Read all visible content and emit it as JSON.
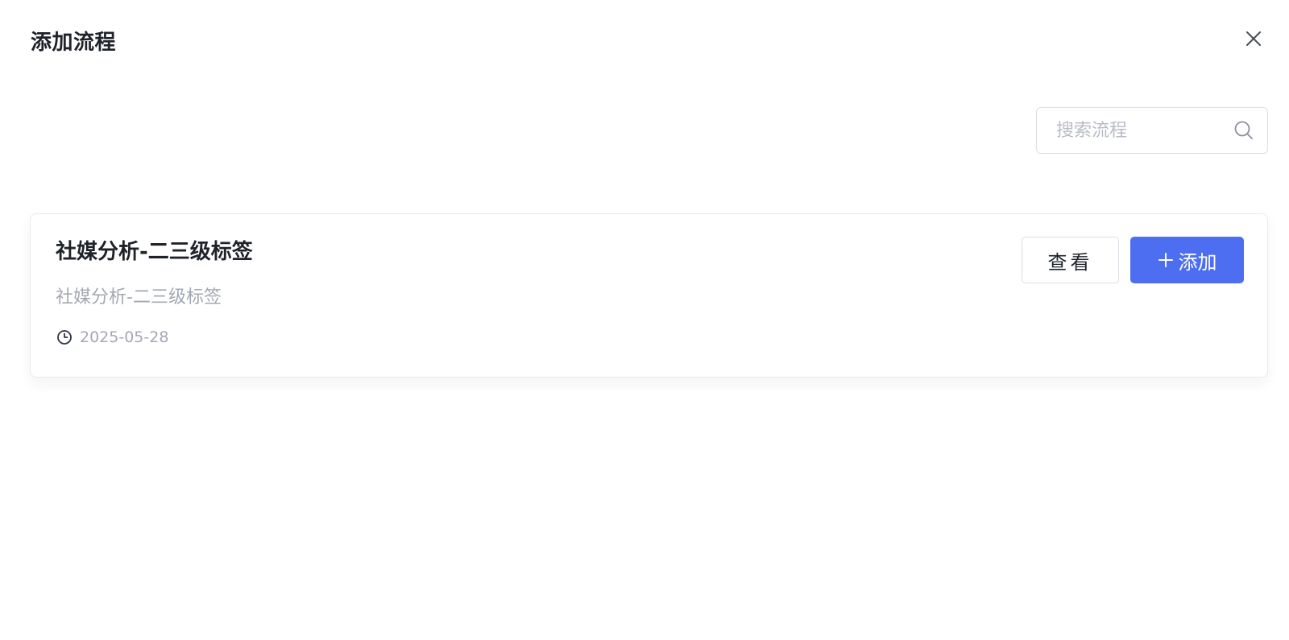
{
  "dialog": {
    "title": "添加流程"
  },
  "search": {
    "placeholder": "搜索流程",
    "value": ""
  },
  "flows": [
    {
      "title": "社媒分析-二三级标签",
      "description": "社媒分析-二三级标签",
      "date": "2025-05-28",
      "view_label": "查看",
      "add_label": "添加"
    }
  ],
  "icons": {
    "close": "close-icon",
    "search": "search-icon",
    "clock": "clock-icon",
    "plus": "plus-icon"
  },
  "colors": {
    "primary": "#4e6ef2",
    "text": "#1f2329",
    "muted": "#a3a8b3",
    "border": "#dcdfe6"
  }
}
